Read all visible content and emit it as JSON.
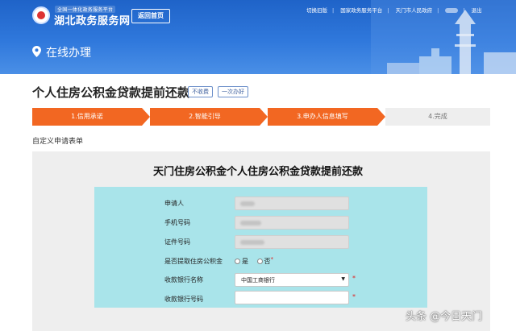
{
  "header": {
    "logo_small": "全国一体化政务服务平台",
    "logo_title": "湖北政务服务网",
    "home_button": "返回首页",
    "links": [
      "切换旧版",
      "国家政务服务平台",
      "天门市人民政府",
      "退出"
    ],
    "section": "在线办理"
  },
  "title": {
    "text": "个人住房公积金贷款提前还款",
    "tags": [
      "不收费",
      "一次办好"
    ]
  },
  "steps": [
    {
      "label": "1.信用承诺",
      "state": "active"
    },
    {
      "label": "2.智能引导",
      "state": "active"
    },
    {
      "label": "3.申办人信息填写",
      "state": "active"
    },
    {
      "label": "4.完成",
      "state": "pending"
    }
  ],
  "subhead": "自定义申请表单",
  "form": {
    "title": "天门住房公积金个人住房公积金贷款提前还款",
    "fields": [
      {
        "label": "申请人",
        "value": ""
      },
      {
        "label": "手机号码",
        "value": ""
      },
      {
        "label": "证件号码",
        "value": ""
      }
    ],
    "withdraw": {
      "label": "是否提取住房公积金",
      "options": [
        "是",
        "否"
      ],
      "required_mark": "*"
    },
    "bank_name": {
      "label": "收款银行名称",
      "value": "中国工商银行",
      "required_mark": "*"
    },
    "bank_account": {
      "label": "收款银行号码",
      "value": "",
      "required_mark": "*"
    }
  },
  "watermark": "头条 @今日天门",
  "colors": {
    "header": "#2f78dc",
    "step_active": "#f26722",
    "form_box": "#a9e4ea",
    "panel": "#eeeeee"
  }
}
